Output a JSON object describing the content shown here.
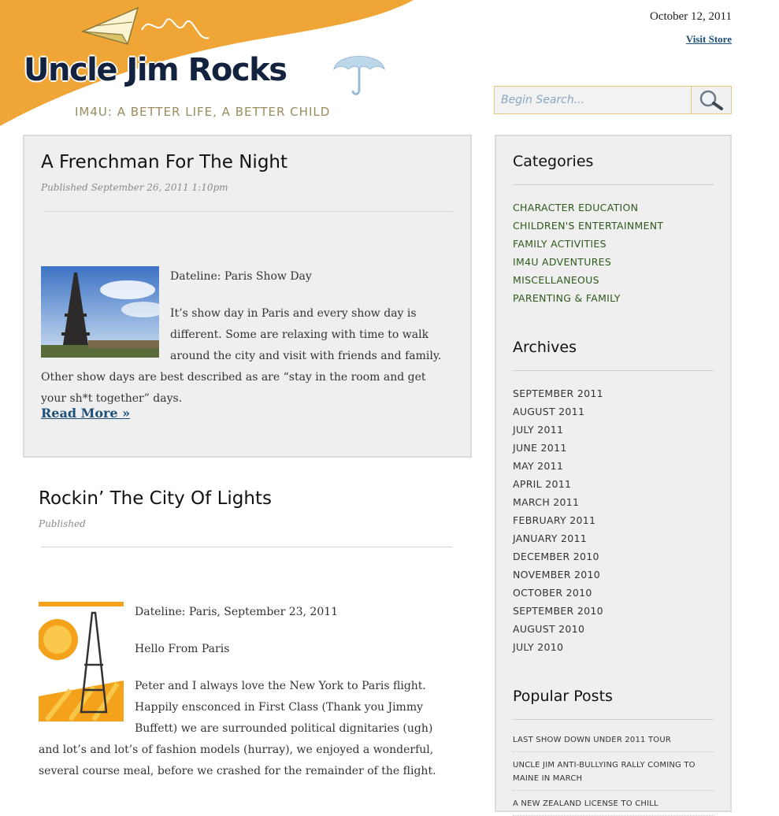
{
  "header": {
    "date": "October 12, 2011",
    "visit_store": "Visit Store",
    "logo_title": "Uncle Jim Rocks",
    "logo_tagline": "IM4U: A BETTER LIFE, A BETTER CHILD",
    "accent_color": "#f0a637"
  },
  "search": {
    "placeholder": "Begin Search..."
  },
  "posts": [
    {
      "title": "A Frenchman For The Night",
      "meta": "Published September 26, 2011 1:10pm",
      "paragraphs": [
        "Dateline: Paris Show Day",
        "It’s show day in Paris and every show day is different. Some are relaxing with time to walk around the city and visit with friends and family. Other show days are best described as are “stay in the room and get your sh*t together” days."
      ],
      "read_more": "Read More »"
    },
    {
      "title": "Rockin’ The City Of Lights",
      "meta": "Published",
      "paragraphs": [
        "Dateline: Paris, September 23, 2011",
        "Hello From Paris",
        "Peter and I always love the New York to Paris flight. Happily ensconced in First Class (Thank you Jimmy Buffett) we are surrounded political dignitaries (ugh) and lot’s and lot’s of fashion models (hurray), we enjoyed a wonderful, several course meal, before we crashed for the remainder of the flight."
      ]
    }
  ],
  "sidebar": {
    "categories_heading": "Categories",
    "categories": [
      "CHARACTER EDUCATION",
      "CHILDREN'S ENTERTAINMENT",
      "FAMILY ACTIVITIES",
      "IM4U ADVENTURES",
      "MISCELLANEOUS",
      "PARENTING & FAMILY"
    ],
    "archives_heading": "Archives",
    "archives": [
      "SEPTEMBER 2011",
      "AUGUST 2011",
      "JULY 2011",
      "JUNE 2011",
      "MAY 2011",
      "APRIL 2011",
      "MARCH 2011",
      "FEBRUARY 2011",
      "JANUARY 2011",
      "DECEMBER 2010",
      "NOVEMBER 2010",
      "OCTOBER 2010",
      "SEPTEMBER 2010",
      "AUGUST 2010",
      "JULY 2010"
    ],
    "popular_heading": "Popular Posts",
    "popular": [
      "LAST SHOW DOWN UNDER 2011 TOUR",
      "UNCLE JIM ANTI-BULLYING RALLY COMING TO MAINE IN MARCH",
      "A NEW ZEALAND LICENSE TO CHILL"
    ]
  }
}
